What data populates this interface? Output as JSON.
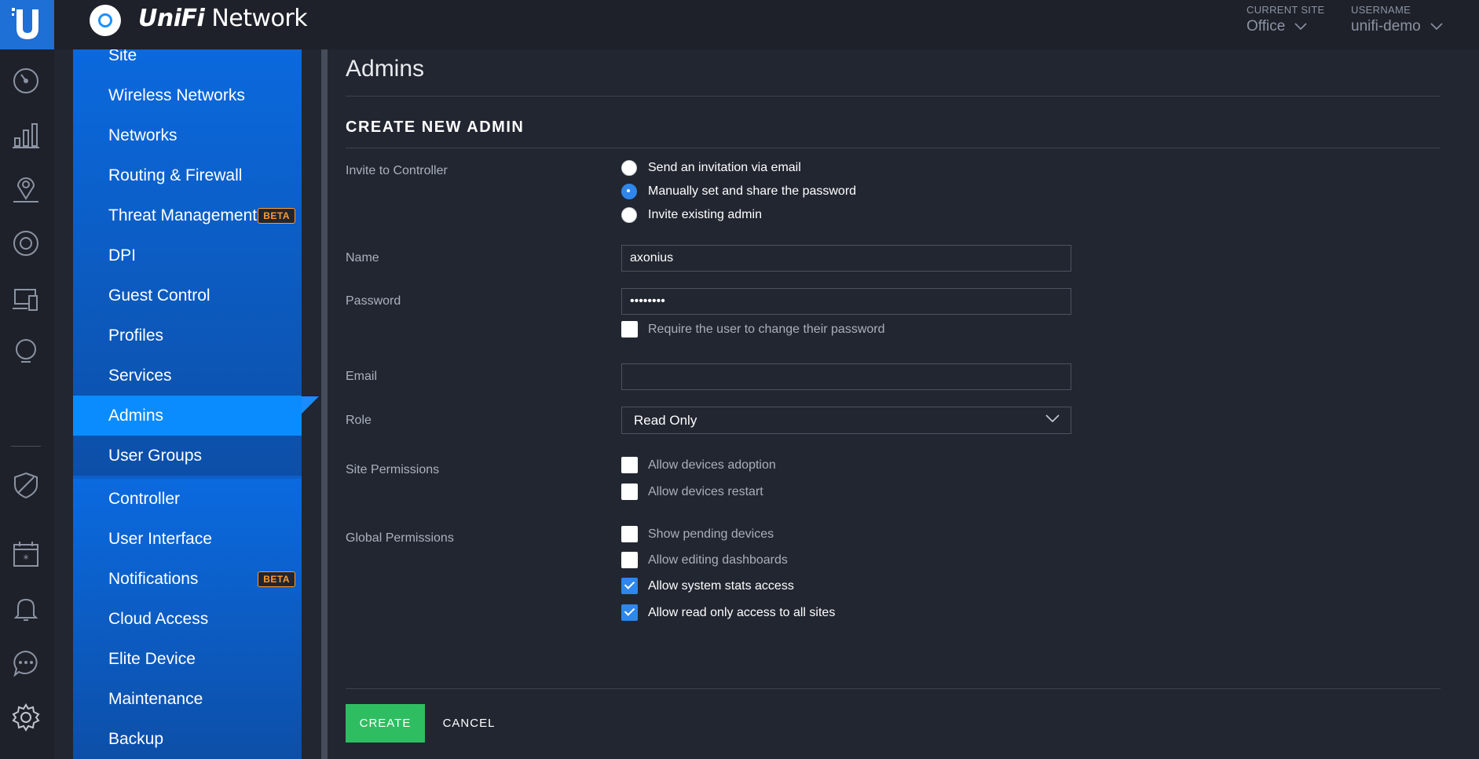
{
  "header": {
    "app_brand": "UniFi",
    "app_name": "Network",
    "current_site_label": "CURRENT SITE",
    "current_site_value": "Office",
    "username_label": "USERNAME",
    "username_value": "unifi-demo"
  },
  "rail_icons": [
    "dashboard-icon",
    "statistics-icon",
    "map-icon",
    "devices-icon",
    "clients-icon",
    "insights-icon",
    "shield-icon",
    "events-icon",
    "alerts-icon",
    "chat-icon",
    "settings-gear-icon"
  ],
  "nav": {
    "group1": [
      {
        "label": "Site"
      },
      {
        "label": "Wireless Networks"
      },
      {
        "label": "Networks"
      },
      {
        "label": "Routing & Firewall"
      },
      {
        "label": "Threat Management",
        "badge": "BETA"
      },
      {
        "label": "DPI"
      },
      {
        "label": "Guest Control"
      },
      {
        "label": "Profiles"
      },
      {
        "label": "Services"
      },
      {
        "label": "Admins",
        "active": true
      },
      {
        "label": "User Groups"
      }
    ],
    "group2": [
      {
        "label": "Controller"
      },
      {
        "label": "User Interface"
      },
      {
        "label": "Notifications",
        "badge": "BETA"
      },
      {
        "label": "Cloud Access"
      },
      {
        "label": "Elite Device"
      },
      {
        "label": "Maintenance"
      },
      {
        "label": "Backup"
      }
    ]
  },
  "page": {
    "title": "Admins",
    "section_title": "CREATE NEW ADMIN",
    "invite": {
      "label": "Invite to Controller",
      "options": [
        {
          "label": "Send an invitation via email",
          "checked": false
        },
        {
          "label": "Manually set and share the password",
          "checked": true
        },
        {
          "label": "Invite existing admin",
          "checked": false
        }
      ]
    },
    "name": {
      "label": "Name",
      "value": "axonius"
    },
    "password": {
      "label": "Password",
      "value": "••••••••",
      "require_change_label": "Require the user to change their password",
      "require_change_checked": false
    },
    "email": {
      "label": "Email",
      "value": ""
    },
    "role": {
      "label": "Role",
      "value": "Read Only"
    },
    "site_permissions": {
      "label": "Site Permissions",
      "options": [
        {
          "label": "Allow devices adoption",
          "checked": false
        },
        {
          "label": "Allow devices restart",
          "checked": false
        }
      ]
    },
    "global_permissions": {
      "label": "Global Permissions",
      "options": [
        {
          "label": "Show pending devices",
          "checked": false
        },
        {
          "label": "Allow editing dashboards",
          "checked": false
        },
        {
          "label": "Allow system stats access",
          "checked": true
        },
        {
          "label": "Allow read only access to all sites",
          "checked": true
        }
      ]
    },
    "buttons": {
      "create": "CREATE",
      "cancel": "CANCEL"
    }
  },
  "colors": {
    "accent": "#0a8cff",
    "create": "#2fbd61",
    "beta": "#ff9a2e",
    "background": "#222631"
  }
}
